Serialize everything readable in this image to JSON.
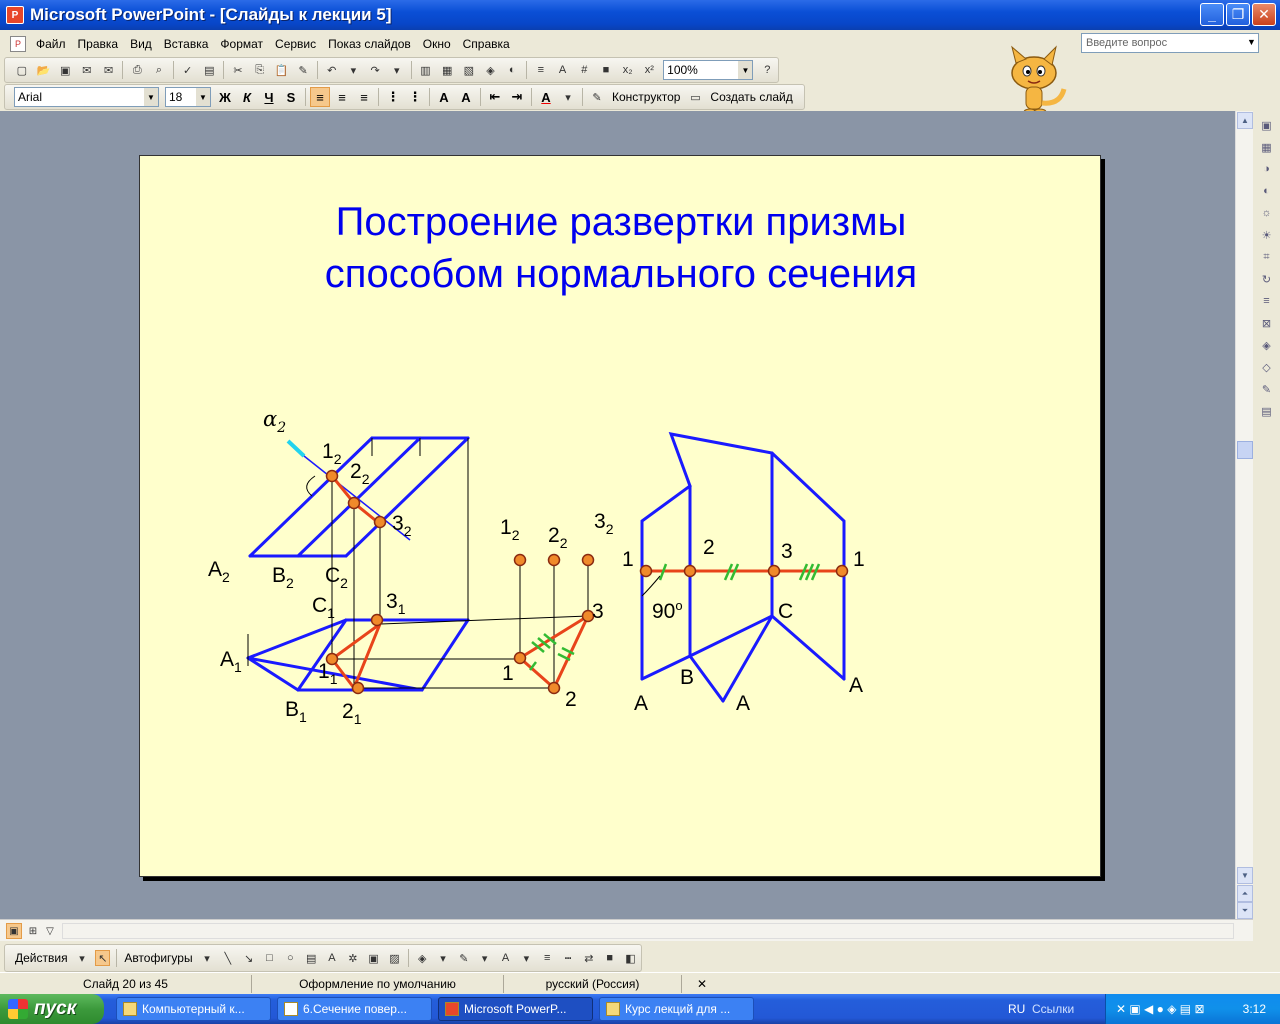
{
  "window": {
    "title": "Microsoft PowerPoint - [Слайды к лекции 5]",
    "controls": [
      "_",
      "❐",
      "✕"
    ]
  },
  "menu": {
    "items": [
      "Файл",
      "Правка",
      "Вид",
      "Вставка",
      "Формат",
      "Сервис",
      "Показ слайдов",
      "Окно",
      "Справка"
    ],
    "ask_placeholder": "Введите вопрос"
  },
  "toolbar_standard": {
    "zoom": "100%"
  },
  "toolbar_format": {
    "font": "Arial",
    "size": "18",
    "bold": "Ж",
    "italic": "К",
    "underline": "Ч",
    "shadow": "S",
    "designer": "Конструктор",
    "new_slide": "Создать слайд"
  },
  "slide": {
    "title_line1": "Построение развертки призмы",
    "title_line2": "способом нормального сечения",
    "labels": {
      "alpha": "α",
      "alpha_sub": "2",
      "p1_2": "1",
      "p1_2s": "2",
      "p2_2": "2",
      "p2_2s": "2",
      "p3_2": "3",
      "p3_2s": "2",
      "A2": "A",
      "A2s": "2",
      "B2": "B",
      "B2s": "2",
      "C2": "C",
      "C2s": "2",
      "C1": "C",
      "C1s": "1",
      "p3_1": "3",
      "p3_1s": "1",
      "A1": "A",
      "A1s": "1",
      "p1_1": "1",
      "p1_1s": "1",
      "B1": "B",
      "B1s": "1",
      "p2_1": "2",
      "p2_1s": "1",
      "mid_1": "1",
      "mid_1s": "2",
      "mid_2": "2",
      "mid_2s": "2",
      "mid_3": "3",
      "mid_3s": "2",
      "tri_3": "3",
      "tri_1": "1",
      "tri_2": "2",
      "dev_1a": "1",
      "dev_2": "2",
      "dev_3": "3",
      "dev_1b": "1",
      "dev_90": "90",
      "dev_deg": "o",
      "dev_C": "C",
      "dev_B": "B",
      "dev_A1": "A",
      "dev_A2": "A",
      "dev_A3": "A"
    }
  },
  "drawing_toolbar": {
    "actions": "Действия",
    "autoshapes": "Автофигуры"
  },
  "status": {
    "slide": "Слайд 20 из 45",
    "design": "Оформление по умолчанию",
    "language": "русский (Россия)"
  },
  "taskbar": {
    "start": "пуск",
    "tasks": [
      "Компьютерный к...",
      "6.Сечение повер...",
      "Microsoft PowerP...",
      "Курс лекций для ..."
    ],
    "lang": "RU",
    "links": "Ссылки",
    "time": "3:12"
  },
  "colors": {
    "title_blue": "#0000ee",
    "slide_bg": "#ffffcc",
    "line_blue": "#1a1aff",
    "section_red": "#e8441a",
    "point_orange": "#f08a2a",
    "tick_green": "#33bb33"
  }
}
